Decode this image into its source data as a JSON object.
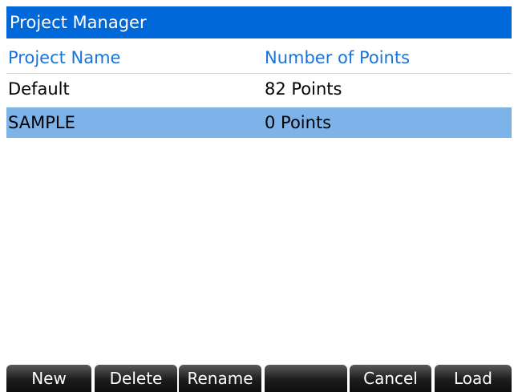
{
  "app": {
    "title": "Project Manager"
  },
  "table": {
    "headers": {
      "name": "Project Name",
      "points": "Number of Points"
    },
    "rows": [
      {
        "name": "Default",
        "points": "82 Points",
        "selected": false
      },
      {
        "name": "SAMPLE",
        "points": "0 Points",
        "selected": true
      }
    ]
  },
  "softkeys": {
    "new": "New",
    "delete": "Delete",
    "rename": "Rename",
    "blank": "",
    "cancel": "Cancel",
    "load": "Load"
  },
  "colors": {
    "title_bar": "#0068d8",
    "header_text": "#1a74d6",
    "selected_row": "#7db3e8",
    "softkey": "#1c1c1c"
  }
}
